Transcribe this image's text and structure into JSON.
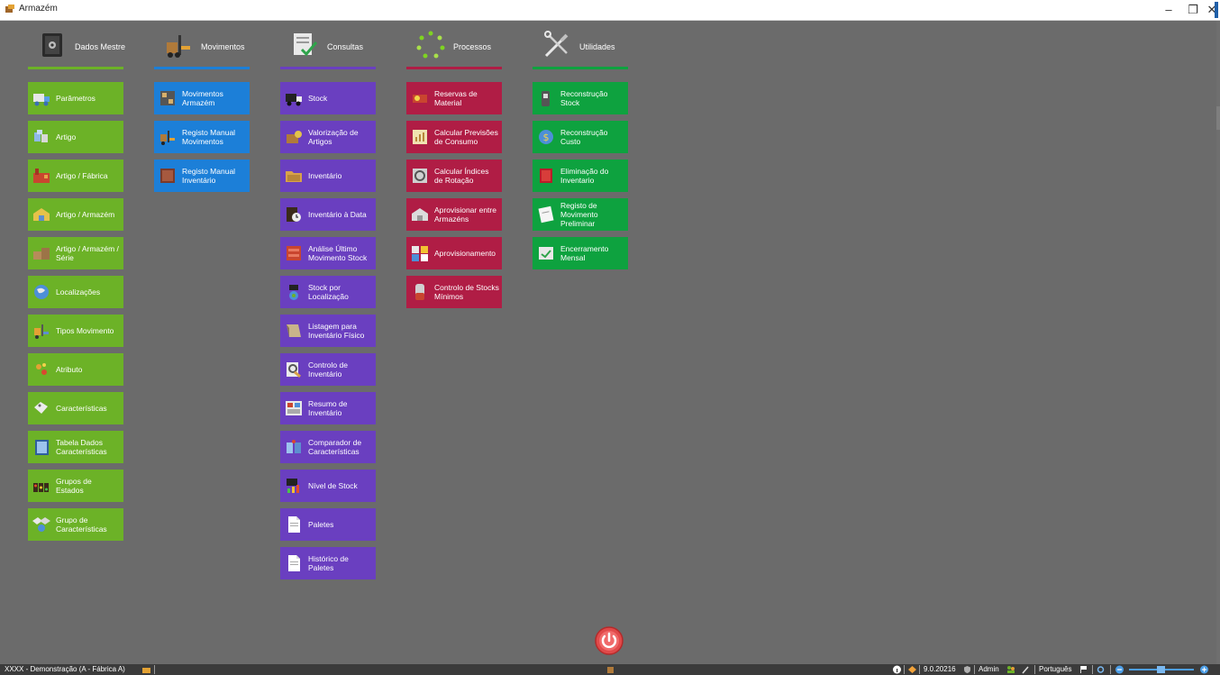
{
  "window": {
    "title": "Armazém",
    "minimize": "–",
    "restore": "❐",
    "close": "✕"
  },
  "colors": {
    "dados_mestre": "#6cb227",
    "movimentos": "#1c7fd8",
    "consultas": "#6a3fc0",
    "processos": "#b01d45",
    "utilidades": "#0ea23f",
    "background": "#6b6b6b"
  },
  "columns": [
    {
      "label": "Dados Mestre",
      "icon": "safe-icon",
      "accent": "#6cb227",
      "items": [
        {
          "label": "Parâmetros",
          "icon": "truck-icon"
        },
        {
          "label": "Artigo",
          "icon": "boxes-icon"
        },
        {
          "label": "Artigo / Fábrica",
          "icon": "factory-icon"
        },
        {
          "label": "Artigo / Armazém",
          "icon": "warehouse-icon"
        },
        {
          "label": "Artigo / Armazém / Série",
          "icon": "series-icon"
        },
        {
          "label": "Localizações",
          "icon": "globe-icon"
        },
        {
          "label": "Tipos Movimento",
          "icon": "forklift-icon"
        },
        {
          "label": "Atributo",
          "icon": "attribute-icon"
        },
        {
          "label": "Características",
          "icon": "tags-icon"
        },
        {
          "label": "Tabela Dados Características",
          "icon": "table-icon"
        },
        {
          "label": "Grupos de Estados",
          "icon": "states-icon"
        },
        {
          "label": "Grupo de Características",
          "icon": "group-icon"
        }
      ]
    },
    {
      "label": "Movimentos",
      "icon": "forklift-icon",
      "accent": "#1c7fd8",
      "items": [
        {
          "label": "Movimentos Armazém",
          "icon": "shelf-icon"
        },
        {
          "label": "Registo Manual Movimentos",
          "icon": "forklift-icon"
        },
        {
          "label": "Registo Manual Inventário",
          "icon": "ledger-icon"
        }
      ]
    },
    {
      "label": "Consultas",
      "icon": "checklist-icon",
      "accent": "#6a3fc0",
      "items": [
        {
          "label": "Stock",
          "icon": "truck-icon"
        },
        {
          "label": "Valorização de Artigos",
          "icon": "valuation-icon"
        },
        {
          "label": "Inventário",
          "icon": "folder-icon"
        },
        {
          "label": "Inventário à Data",
          "icon": "clock-icon"
        },
        {
          "label": "Análise Último Movimento Stock",
          "icon": "cabinet-icon"
        },
        {
          "label": "Stock por Localização",
          "icon": "location-icon"
        },
        {
          "label": "Listagem para Inventário Físico",
          "icon": "list-icon"
        },
        {
          "label": "Controlo de Inventário",
          "icon": "magnifier-icon"
        },
        {
          "label": "Resumo de Inventário",
          "icon": "summary-icon"
        },
        {
          "label": "Comparador de Características",
          "icon": "compare-icon"
        },
        {
          "label": "Nível de Stock",
          "icon": "stock-level-icon"
        },
        {
          "label": "Paletes",
          "icon": "document-icon"
        },
        {
          "label": "Histórico de Paletes",
          "icon": "document-icon"
        }
      ]
    },
    {
      "label": "Processos",
      "icon": "cycle-icon",
      "accent": "#b01d45",
      "items": [
        {
          "label": "Reservas de Material",
          "icon": "reservation-icon"
        },
        {
          "label": "Calcular Previsões de Consumo",
          "icon": "forecast-icon"
        },
        {
          "label": "Calcular Índices de Rotação",
          "icon": "rotation-icon"
        },
        {
          "label": "Aprovisionar entre Armazéns",
          "icon": "transfer-icon"
        },
        {
          "label": "Aprovisionamento",
          "icon": "supply-icon"
        },
        {
          "label": "Controlo de Stocks Mínimos",
          "icon": "barrel-icon"
        }
      ]
    },
    {
      "label": "Utilidades",
      "icon": "tools-icon",
      "accent": "#0ea23f",
      "items": [
        {
          "label": "Reconstrução Stock",
          "icon": "rebuild-icon"
        },
        {
          "label": "Reconstrução Custo",
          "icon": "cost-icon"
        },
        {
          "label": "Eliminação do Inventario",
          "icon": "book-delete-icon"
        },
        {
          "label": "Registo de Movimento Preliminar",
          "icon": "note-icon"
        },
        {
          "label": "Encerramento Mensal",
          "icon": "close-month-icon"
        }
      ]
    }
  ],
  "power": {
    "icon": "power-icon"
  },
  "statusbar": {
    "company": "XXXX - Demonstração (A - Fábrica A)",
    "version": "9.0.20216",
    "user": "Admin",
    "language": "Português"
  }
}
